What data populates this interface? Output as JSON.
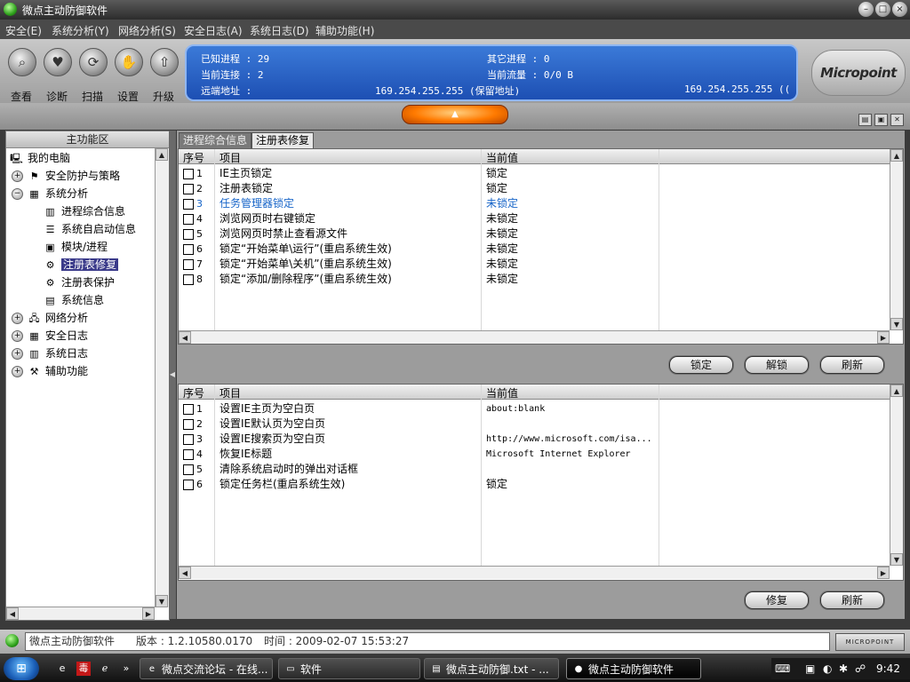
{
  "window": {
    "title": "微点主动防御软件"
  },
  "menu": [
    "安全(E)",
    "系统分析(Y)",
    "网络分析(S)",
    "安全日志(A)",
    "系统日志(D)",
    "辅助功能(H)"
  ],
  "toolbar": [
    {
      "label": "查看",
      "icon": "magnifier-icon"
    },
    {
      "label": "诊断",
      "icon": "heart-icon"
    },
    {
      "label": "扫描",
      "icon": "scan-icon"
    },
    {
      "label": "设置",
      "icon": "hand-icon"
    },
    {
      "label": "升级",
      "icon": "upgrade-icon"
    }
  ],
  "info": {
    "known_label": "已知进程 : 29",
    "other_label": "其它进程 : 0",
    "conn_label": "当前连接 : 2",
    "flow_label": "当前流量 : 0/0 B",
    "remote_label": "远端地址 :",
    "remote_value": "169.254.255.255 (保留地址)",
    "remote_value2": "169.254.255.255 (("
  },
  "logo": "Micropoint",
  "left_panel": {
    "header": "主功能区",
    "root": "我的电脑",
    "items": {
      "security": "安全防护与策略",
      "sysanalysis": "系统分析",
      "proc_info": "进程综合信息",
      "startup": "系统自启动信息",
      "modules": "模块/进程",
      "reg_repair": "注册表修复",
      "reg_protect": "注册表保护",
      "sysinfo": "系统信息",
      "netanalysis": "网络分析",
      "seclog": "安全日志",
      "syslog": "系统日志",
      "aux": "辅助功能"
    }
  },
  "tabs": [
    "进程综合信息",
    "注册表修复"
  ],
  "columns": {
    "index": "序号",
    "item": "项目",
    "value": "当前值"
  },
  "top_rows": [
    {
      "n": "1",
      "item": "IE主页锁定",
      "value": "锁定"
    },
    {
      "n": "2",
      "item": "注册表锁定",
      "value": "锁定"
    },
    {
      "n": "3",
      "item": "任务管理器锁定",
      "value": "未锁定"
    },
    {
      "n": "4",
      "item": "浏览网页时右键锁定",
      "value": "未锁定"
    },
    {
      "n": "5",
      "item": "浏览网页时禁止查看源文件",
      "value": "未锁定"
    },
    {
      "n": "6",
      "item": "锁定“开始菜单\\运行”(重启系统生效)",
      "value": "未锁定"
    },
    {
      "n": "7",
      "item": "锁定“开始菜单\\关机”(重启系统生效)",
      "value": "未锁定"
    },
    {
      "n": "8",
      "item": "锁定“添加/删除程序”(重启系统生效)",
      "value": "未锁定"
    }
  ],
  "top_buttons": {
    "lock": "锁定",
    "unlock": "解锁",
    "refresh": "刷新"
  },
  "bottom_rows": [
    {
      "n": "1",
      "item": "设置IE主页为空白页",
      "value": "about:blank"
    },
    {
      "n": "2",
      "item": "设置IE默认页为空白页",
      "value": ""
    },
    {
      "n": "3",
      "item": "设置IE搜索页为空白页",
      "value": "http://www.microsoft.com/isa..."
    },
    {
      "n": "4",
      "item": "恢复IE标题",
      "value": "Microsoft Internet Explorer"
    },
    {
      "n": "5",
      "item": "清除系统启动时的弹出对话框",
      "value": ""
    },
    {
      "n": "6",
      "item": "锁定任务栏(重启系统生效)",
      "value": "锁定"
    }
  ],
  "bottom_buttons": {
    "repair": "修复",
    "refresh": "刷新"
  },
  "status": {
    "app": "微点主动防御软件",
    "version": "版本 : 1.2.10580.0170",
    "time": "时间 : 2009-02-07 15:53:27",
    "brand": "MICROPOINT"
  },
  "taskbar": {
    "tasks": [
      "微点交流论坛 - 在线...",
      "软件",
      "微点主动防御.txt - ...",
      "微点主动防御软件"
    ],
    "clock": "9:42"
  },
  "colors": {
    "highlight": "#1664c8",
    "selection": "#3a3a8a",
    "panel_blue": "#2a62c8"
  }
}
